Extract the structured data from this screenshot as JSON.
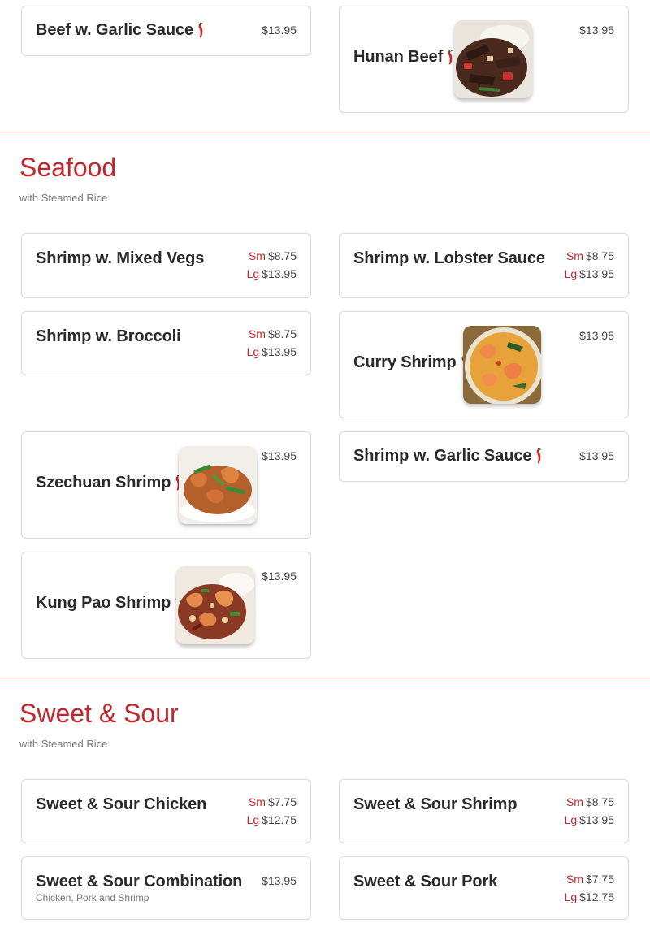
{
  "top_items": [
    {
      "name": "Beef w. Garlic Sauce",
      "spicy": true,
      "price": "$13.95"
    },
    {
      "name": "Hunan Beef",
      "spicy": true,
      "price": "$13.95",
      "image": "hunan-beef"
    }
  ],
  "seafood": {
    "title": "Seafood",
    "subtitle": "with Steamed Rice",
    "items": [
      {
        "name": "Shrimp w. Mixed Vegs",
        "sm_label": "Sm",
        "sm_price": "$8.75",
        "lg_label": "Lg",
        "lg_price": "$13.95"
      },
      {
        "name": "Shrimp w. Lobster Sauce",
        "sm_label": "Sm",
        "sm_price": "$8.75",
        "lg_label": "Lg",
        "lg_price": "$13.95"
      },
      {
        "name": "Shrimp w. Broccoli",
        "sm_label": "Sm",
        "sm_price": "$8.75",
        "lg_label": "Lg",
        "lg_price": "$13.95"
      },
      {
        "name": "Curry Shrimp",
        "spicy": true,
        "price": "$13.95",
        "image": "curry-shrimp"
      },
      {
        "name": "Szechuan Shrimp",
        "spicy": true,
        "price": "$13.95",
        "image": "szechuan-shrimp"
      },
      {
        "name": "Shrimp w. Garlic Sauce",
        "spicy": true,
        "price": "$13.95"
      },
      {
        "name": "Kung Pao Shrimp",
        "spicy": true,
        "price": "$13.95",
        "image": "kung-pao-shrimp"
      }
    ]
  },
  "sweet_sour": {
    "title": "Sweet & Sour",
    "subtitle": "with Steamed Rice",
    "items": [
      {
        "name": "Sweet & Sour Chicken",
        "sm_label": "Sm",
        "sm_price": "$7.75",
        "lg_label": "Lg",
        "lg_price": "$12.75"
      },
      {
        "name": "Sweet & Sour Shrimp",
        "sm_label": "Sm",
        "sm_price": "$8.75",
        "lg_label": "Lg",
        "lg_price": "$13.95"
      },
      {
        "name": "Sweet & Sour Combination",
        "description": "Chicken, Pork and Shrimp",
        "price": "$13.95"
      },
      {
        "name": "Sweet & Sour Pork",
        "sm_label": "Sm",
        "sm_price": "$7.75",
        "lg_label": "Lg",
        "lg_price": "$12.75"
      }
    ]
  },
  "colors": {
    "accent": "#c0272d",
    "divider": "#d8575d",
    "border": "#d9d9d9"
  },
  "icons": {
    "spicy": "chili-pepper-icon"
  }
}
